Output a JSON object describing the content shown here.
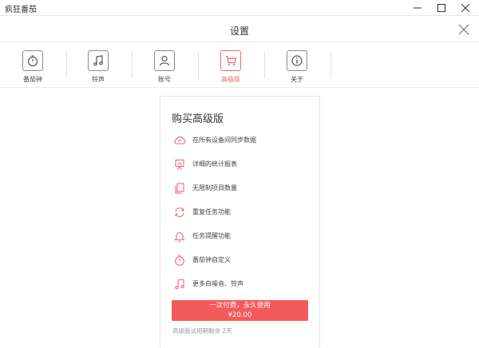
{
  "window": {
    "title": "疯狂番茄"
  },
  "header": {
    "title": "设置"
  },
  "tabs": [
    {
      "label": "番茄钟",
      "icon": "stopwatch-icon",
      "active": false
    },
    {
      "label": "铃声",
      "icon": "music-note-icon",
      "active": false
    },
    {
      "label": "账号",
      "icon": "user-icon",
      "active": false
    },
    {
      "label": "高级版",
      "icon": "cart-icon",
      "active": true
    },
    {
      "label": "关于",
      "icon": "info-icon",
      "active": false
    }
  ],
  "premium": {
    "title": "购买高级版",
    "features": [
      {
        "label": "在所有设备间同步数据",
        "icon": "cloud-sync-icon"
      },
      {
        "label": "详细的统计报表",
        "icon": "chart-board-icon"
      },
      {
        "label": "无限制项目数量",
        "icon": "documents-icon"
      },
      {
        "label": "重复任务功能",
        "icon": "repeat-icon"
      },
      {
        "label": "任务提醒功能",
        "icon": "bell-icon"
      },
      {
        "label": "番茄钟自定义",
        "icon": "stopwatch-icon"
      },
      {
        "label": "更多白噪音、铃声",
        "icon": "music-note-icon"
      }
    ],
    "buy_button": {
      "line1": "一次付费，永久使用",
      "line2": "¥20.00"
    },
    "trial_text": "高级版试用期剩余 2天"
  },
  "colors": {
    "accent": "#f55a5a",
    "icon_accent": "#f06a6a",
    "icon_gray": "#8c8c8c"
  }
}
